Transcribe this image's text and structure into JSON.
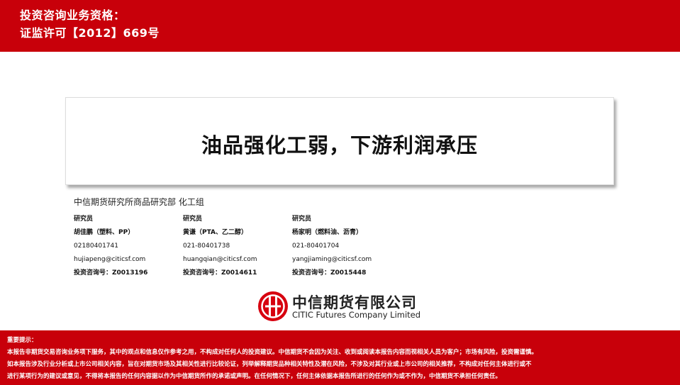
{
  "header": {
    "qualification_line1": "投资咨询业务资格：",
    "qualification_line2": "证监许可【2012】669号"
  },
  "report": {
    "title": "油品强化工弱，下游利润承压"
  },
  "department": "中信期货研究所商品研究部 化工组",
  "analysts": [
    {
      "role": "研究员",
      "name": "胡佳鹏（塑料、PP）",
      "phone": "02180401741",
      "email": "hujiapeng@citicsf.com",
      "license": "投资咨询号：Z0013196"
    },
    {
      "role": "研究员",
      "name": "黄谦（PTA、乙二醇）",
      "phone": "021-80401738",
      "email": "huangqian@citicsf.com",
      "license": "投资咨询号：Z0014611"
    },
    {
      "role": "研究员",
      "name": "杨家明（燃料油、沥青）",
      "phone": "021-80401704",
      "email": "yangjiaming@citicsf.com",
      "license": "投资咨询号：Z0015448"
    }
  ],
  "logo": {
    "name_cn": "中信期货有限公司",
    "name_en": "CITIC Futures Company Limited"
  },
  "footer": {
    "heading": "重要提示：",
    "line1": "本报告非期货交易咨询业务项下服务，其中的观点和信息仅作参考之用，不构成对任何人的投资建议。中信期货不会因为关注、收到或阅读本报告内容而视相关人员为客户；市场有风险，投资需谨慎。",
    "line2": "如本报告涉及行业分析或上市公司相关内容，旨在对期货市场及其相关性进行比较论证，列举解释期货品种相关特性及潜在风险，不涉及对其行业或上市公司的相关推荐，不构成对任何主体进行或不",
    "line3": "进行某项行为的建议或意见，不得将本报告的任何内容据以作为中信期货所作的承诺或声明。在任何情况下，任何主体依据本报告所进行的任何作为或不作为，中信期货不承担任何责任。"
  },
  "colors": {
    "brand_red": "#c8000a"
  }
}
